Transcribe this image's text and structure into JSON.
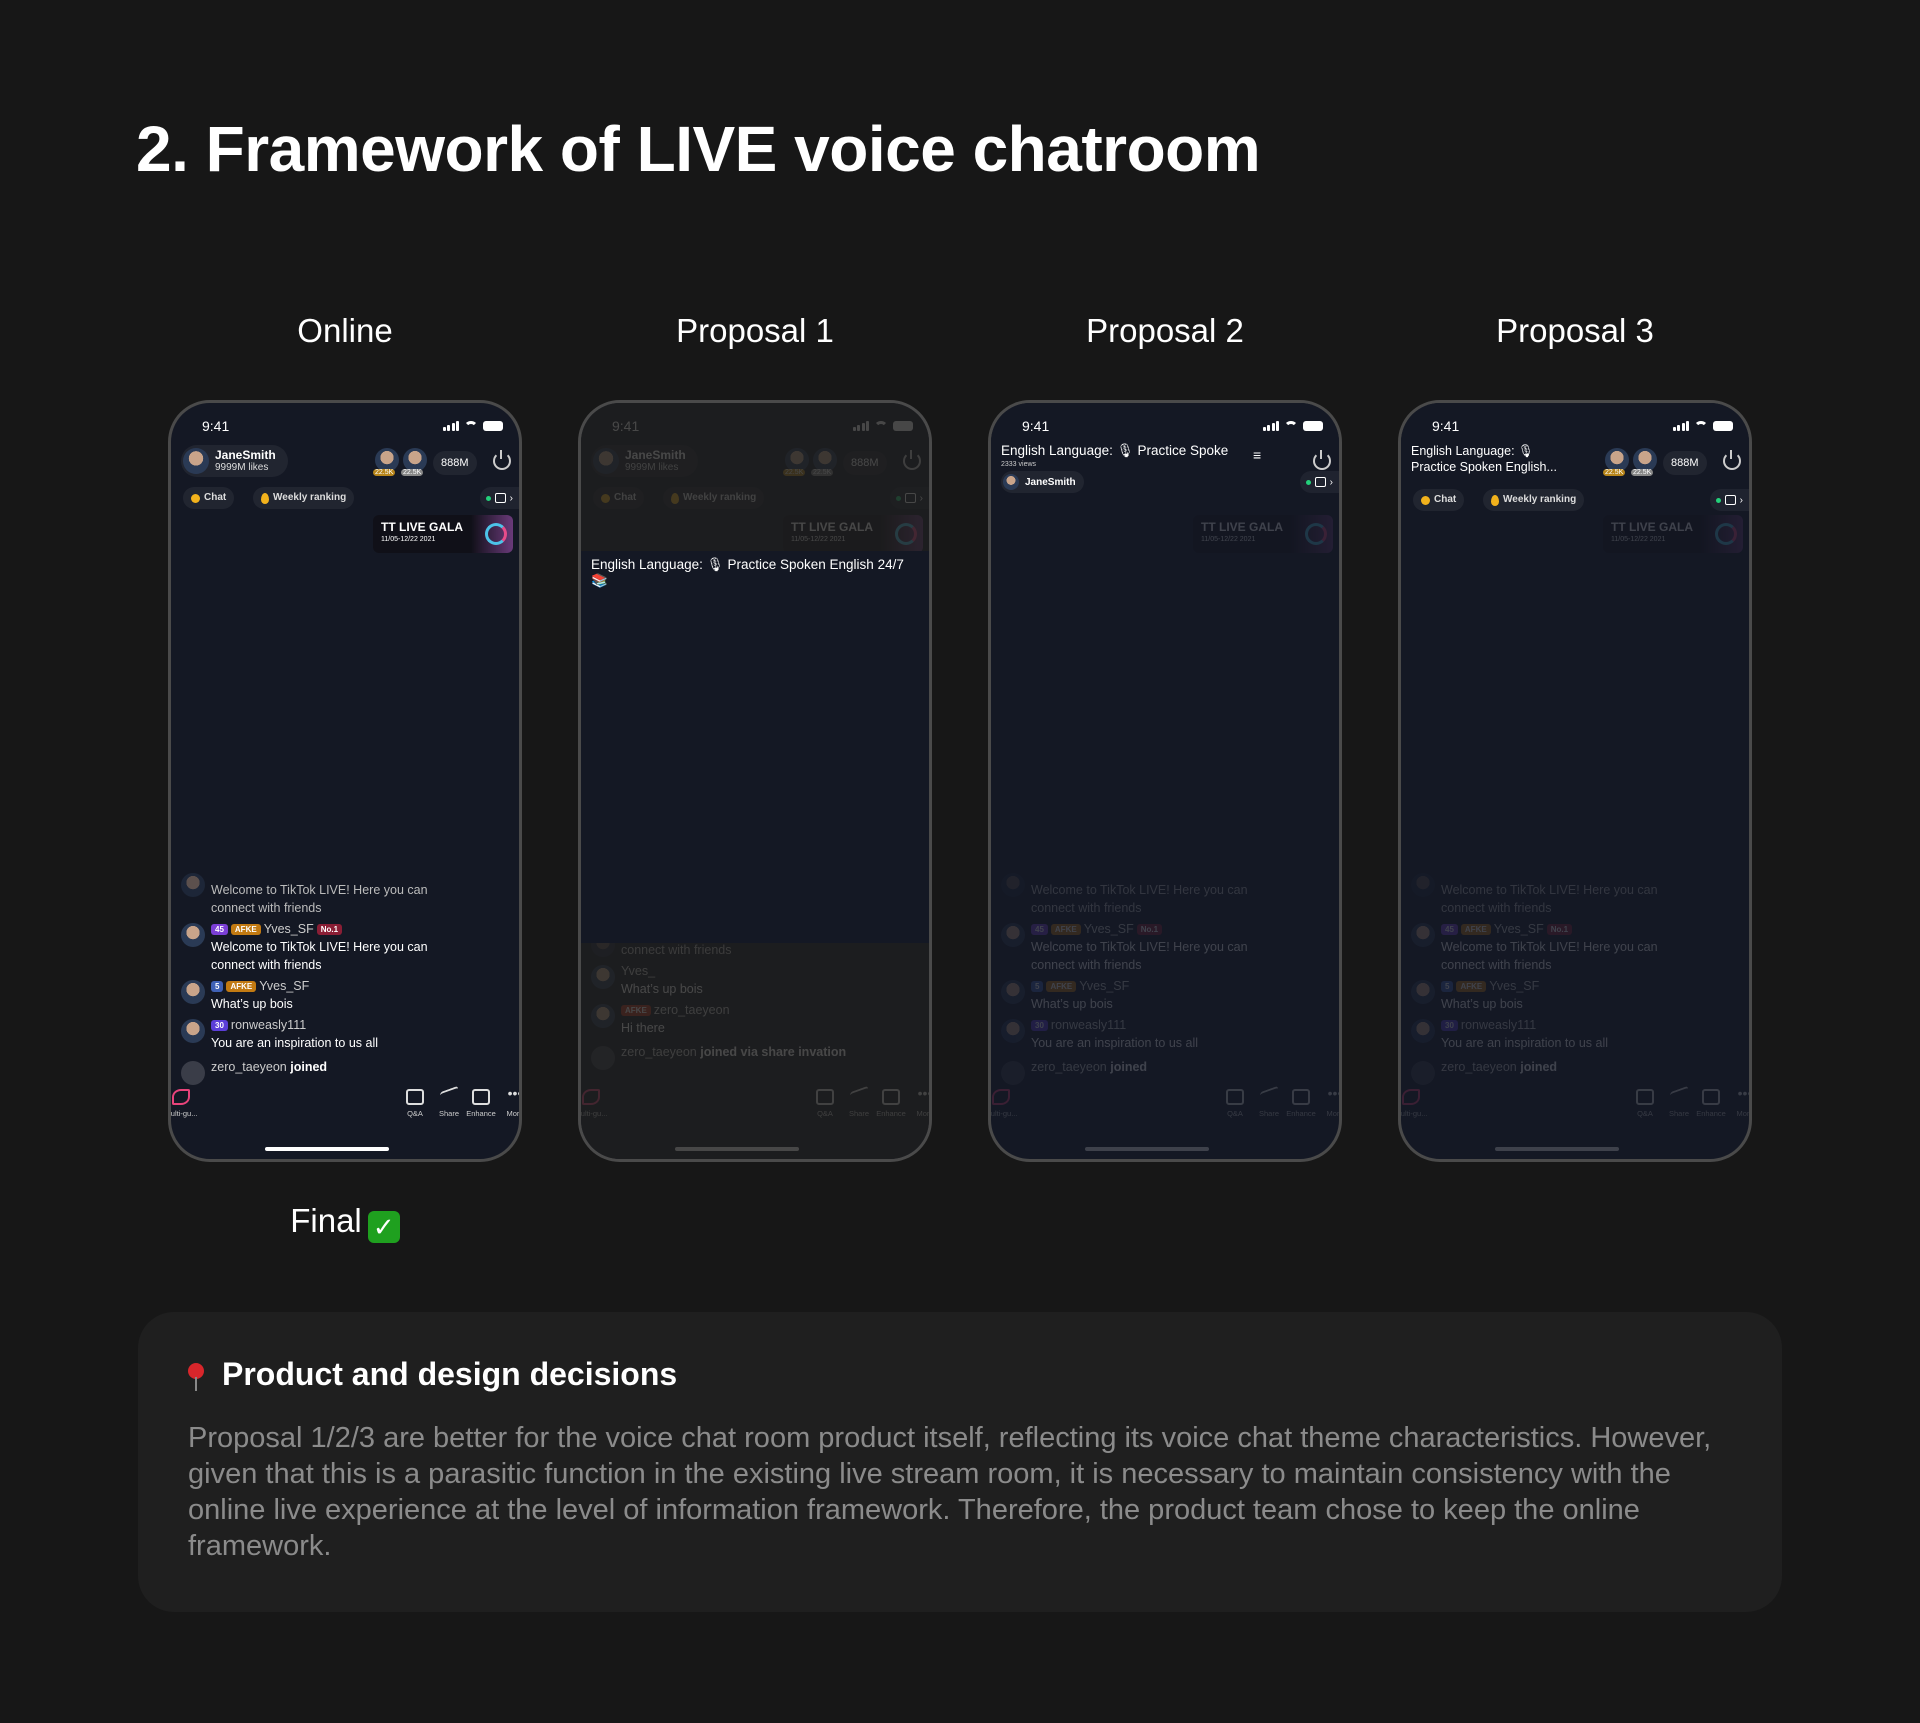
{
  "title": "2. Framework of LIVE voice chatroom",
  "final_label": "Final",
  "final_icon": "check-mark-button",
  "phones": [
    {
      "label": "Online",
      "time": "9:41",
      "host": {
        "name": "JaneSmith",
        "likes": "9999M likes"
      },
      "top_viewers": [
        "22.5K",
        "22.5K"
      ],
      "viewers": "888M",
      "chips": [
        "Chat",
        "Weekly ranking"
      ],
      "gala": {
        "title": "TT LIVE GALA",
        "dates": "11/05-12/22 2021"
      },
      "chat": [
        {
          "text": "Welcome to TikTok LIVE! Here you can connect with friends",
          "faded": true
        },
        {
          "badges": [
            {
              "t": "45",
              "c": "#7b3fd6"
            },
            {
              "t": "AFKE",
              "c": "#c27a12"
            }
          ],
          "user": "Yves_SF",
          "rank": "No.1",
          "text": "Welcome to TikTok LIVE! Here you can connect with friends"
        },
        {
          "badges": [
            {
              "t": "5",
              "c": "#3f61b5"
            },
            {
              "t": "AFKE",
              "c": "#c27a12"
            }
          ],
          "user": "Yves_SF",
          "text": "What’s up bois"
        },
        {
          "badges": [
            {
              "t": "30",
              "c": "#5b3ed8"
            }
          ],
          "user": "ronweasly111",
          "text": "You are an inspiration to us all"
        },
        {
          "join": true,
          "user": "zero_taeyeon",
          "text": "joined"
        }
      ],
      "bottom": [
        "Multi-gu...",
        "Q&A",
        "Share",
        "Enhance",
        "More"
      ]
    },
    {
      "label": "Proposal 1",
      "time": "9:41",
      "host": {
        "name": "JaneSmith",
        "likes": "9999M likes"
      },
      "top_viewers": [
        "22.5K",
        "22.5K"
      ],
      "viewers": "888M",
      "chips": [
        "Chat",
        "Weekly ranking"
      ],
      "gala": {
        "title": "TT LIVE GALA",
        "dates": "11/05-12/22 2021"
      },
      "room_title": "English Language: 🎙 Practice Spoken English 24/7 📚",
      "chat": [
        {
          "text": "connect with friends",
          "faded": true
        },
        {
          "user": "Yves_",
          "text": "What’s up bois"
        },
        {
          "user": "zero_taeyeon",
          "badges": [
            {
              "t": "AFKE",
              "c": "#b8321f"
            }
          ],
          "text": "Hi there"
        },
        {
          "join": true,
          "user": "zero_taeyeon",
          "text": "joined via share invation"
        }
      ],
      "bottom": [
        "Multi-gu...",
        "Q&A",
        "Share",
        "Enhance",
        "More"
      ]
    },
    {
      "label": "Proposal 2",
      "time": "9:41",
      "room_title": "English Language: 🎙 Practice Spoke",
      "views": "2333 views",
      "host": {
        "name": "JaneSmith"
      },
      "gala": {
        "title": "TT LIVE GALA",
        "dates": "11/05-12/22 2021"
      },
      "chat": [
        {
          "text": "Welcome to TikTok LIVE! Here you can connect with friends",
          "faded": true
        },
        {
          "badges": [
            {
              "t": "45",
              "c": "#7b3fd6"
            },
            {
              "t": "AFKE",
              "c": "#c27a12"
            }
          ],
          "user": "Yves_SF",
          "rank": "No.1",
          "text": "Welcome to TikTok LIVE! Here you can connect with friends"
        },
        {
          "badges": [
            {
              "t": "5",
              "c": "#3f61b5"
            },
            {
              "t": "AFKE",
              "c": "#c27a12"
            }
          ],
          "user": "Yves_SF",
          "text": "What’s up bois"
        },
        {
          "badges": [
            {
              "t": "30",
              "c": "#5b3ed8"
            }
          ],
          "user": "ronweasly111",
          "text": "You are an inspiration to us all"
        },
        {
          "join": true,
          "user": "zero_taeyeon",
          "text": "joined"
        }
      ],
      "bottom": [
        "Multi-gu...",
        "Q&A",
        "Share",
        "Enhance",
        "More"
      ]
    },
    {
      "label": "Proposal 3",
      "time": "9:41",
      "room_title": "English Language: 🎙 Practice Spoken English...",
      "top_viewers": [
        "22.5K",
        "22.5K"
      ],
      "viewers": "888M",
      "chips": [
        "Chat",
        "Weekly ranking"
      ],
      "gala": {
        "title": "TT LIVE GALA",
        "dates": "11/05-12/22 2021"
      },
      "chat": [
        {
          "text": "Welcome to TikTok LIVE! Here you can connect with friends",
          "faded": true
        },
        {
          "badges": [
            {
              "t": "45",
              "c": "#7b3fd6"
            },
            {
              "t": "AFKE",
              "c": "#c27a12"
            }
          ],
          "user": "Yves_SF",
          "rank": "No.1",
          "text": "Welcome to TikTok LIVE! Here you can connect with friends"
        },
        {
          "badges": [
            {
              "t": "5",
              "c": "#3f61b5"
            },
            {
              "t": "AFKE",
              "c": "#c27a12"
            }
          ],
          "user": "Yves_SF",
          "text": "What’s up bois"
        },
        {
          "badges": [
            {
              "t": "30",
              "c": "#5b3ed8"
            }
          ],
          "user": "ronweasly111",
          "text": "You are an inspiration to us all"
        },
        {
          "join": true,
          "user": "zero_taeyeon",
          "text": "joined"
        }
      ],
      "bottom": [
        "Multi-gu...",
        "Q&A",
        "Share",
        "Enhance",
        "More"
      ]
    }
  ],
  "decisions": {
    "heading": "Product and design decisions",
    "icon": "round-pushpin",
    "body": "Proposal 1/2/3 are better for the voice chat room product itself, reflecting its voice chat theme characteristics. However, given that this is a parasitic function in the existing live stream room, it is necessary to maintain consistency with the online live experience at the level of information framework. Therefore, the product team chose to keep the online framework."
  }
}
